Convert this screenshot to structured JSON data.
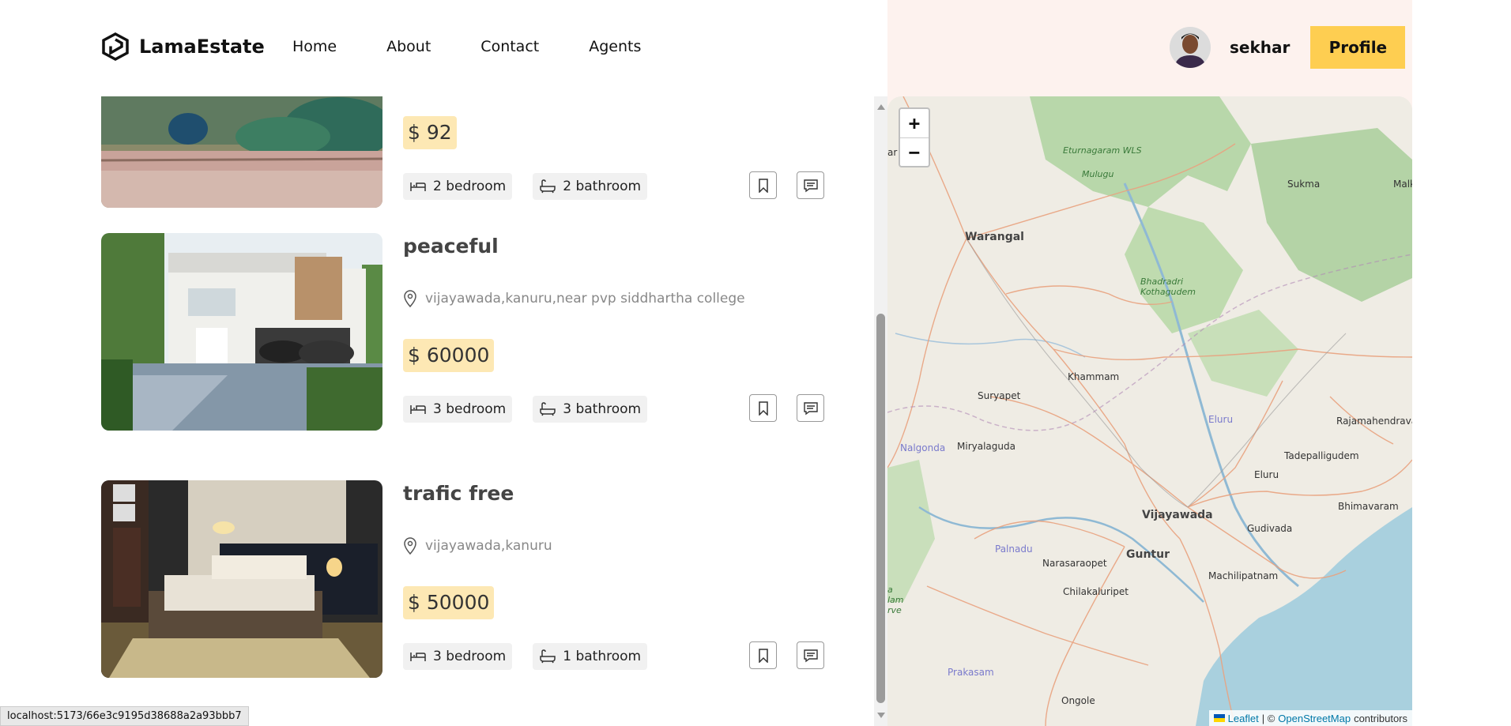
{
  "navbar": {
    "brand": "LamaEstate",
    "links": [
      "Home",
      "About",
      "Contact",
      "Agents"
    ],
    "username": "sekhar",
    "profile_label": "Profile"
  },
  "listings": [
    {
      "title": "",
      "address": "",
      "price": "$ 92",
      "bedrooms": "2 bedroom",
      "bathrooms": "2 bathroom"
    },
    {
      "title": "peaceful",
      "address": "vijayawada,kanuru,near pvp siddhartha college",
      "price": "$ 60000",
      "bedrooms": "3 bedroom",
      "bathrooms": "3 bathroom"
    },
    {
      "title": "trafic free",
      "address": "vijayawada,kanuru",
      "price": "$ 50000",
      "bedrooms": "3 bedroom",
      "bathrooms": "1 bathroom"
    }
  ],
  "map": {
    "zoom_in": "+",
    "zoom_out": "−",
    "labels": {
      "warangal": "Warangal",
      "eturnagaram": "Eturnagaram WLS",
      "mulugu": "Mulugu",
      "sukma": "Sukma",
      "mal": "Malk",
      "bhadradri": "Bhadradri Kothagudem",
      "khammam": "Khammam",
      "suryapet": "Suryapet",
      "nalgonda": "Nalgonda",
      "miryalaguda": "Miryalaguda",
      "eluru_dist": "Eluru",
      "rajamahendra": "Rajamahendrava",
      "tadepalli": "Tadepalligudem",
      "eluru": "Eluru",
      "bhimavaram": "Bhimavaram",
      "vijayawada": "Vijayawada",
      "gudivada": "Gudivada",
      "palnadu": "Palnadu",
      "narasaraopet": "Narasaraopet",
      "guntur": "Guntur",
      "chilakaluripet": "Chilakaluripet",
      "machilipatnam": "Machilipatnam",
      "prakasam": "Prakasam",
      "ongole": "Ongole",
      "ar": "ar",
      "nallamala": "a lam rve"
    },
    "attribution": {
      "leaflet": "Leaflet",
      "separator": "| ©",
      "osm": "OpenStreetMap",
      "contributors": "contributors"
    }
  },
  "status_url": "localhost:5173/66e3c9195d38688a2a93bbb7",
  "colors": {
    "accent": "#fece51",
    "price_bg": "#fde8b4",
    "map_bg": "#fdf2ee",
    "link": "#0078a8"
  }
}
